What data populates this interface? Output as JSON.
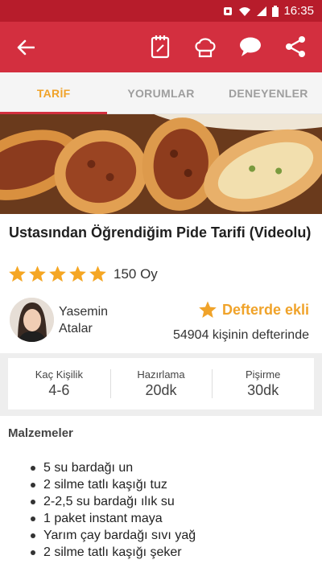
{
  "status_bar": {
    "time": "16:35",
    "icons": [
      "notification-icon",
      "wifi-icon",
      "signal-icon",
      "battery-icon"
    ]
  },
  "app_bar": {
    "icons": [
      "back-arrow-icon",
      "notebook-icon",
      "chef-hat-icon",
      "comment-icon",
      "share-icon"
    ]
  },
  "tabs": [
    {
      "label": "TARİF",
      "active": true
    },
    {
      "label": "YORUMLAR",
      "active": false
    },
    {
      "label": "DENEYENLER",
      "active": false
    }
  ],
  "recipe": {
    "title": "Ustasından Öğrendiğim Pide Tarifi (Videolu)",
    "rating": 5,
    "votes": "150 Oy"
  },
  "author": {
    "name": "Yasemin Atalar"
  },
  "notebook": {
    "label": "Defterde ekli",
    "count_text": "54904 kişinin defterinde"
  },
  "stats": [
    {
      "label": "Kaç Kişilik",
      "value": "4-6"
    },
    {
      "label": "Hazırlama",
      "value": "20dk"
    },
    {
      "label": "Pişirme",
      "value": "30dk"
    }
  ],
  "ingredients": {
    "title": "Malzemeler",
    "items": [
      "5 su bardağı un",
      "2 silme tatlı kaşığı tuz",
      "2-2,5 su bardağı ılık su",
      "1 paket instant maya",
      "Yarım çay bardağı sıvı yağ",
      "2 silme tatlı kaşığı şeker"
    ]
  },
  "colors": {
    "primary": "#d32f3f",
    "status": "#b71c2b",
    "accent": "#f0a32a",
    "star": "#f5a623"
  }
}
